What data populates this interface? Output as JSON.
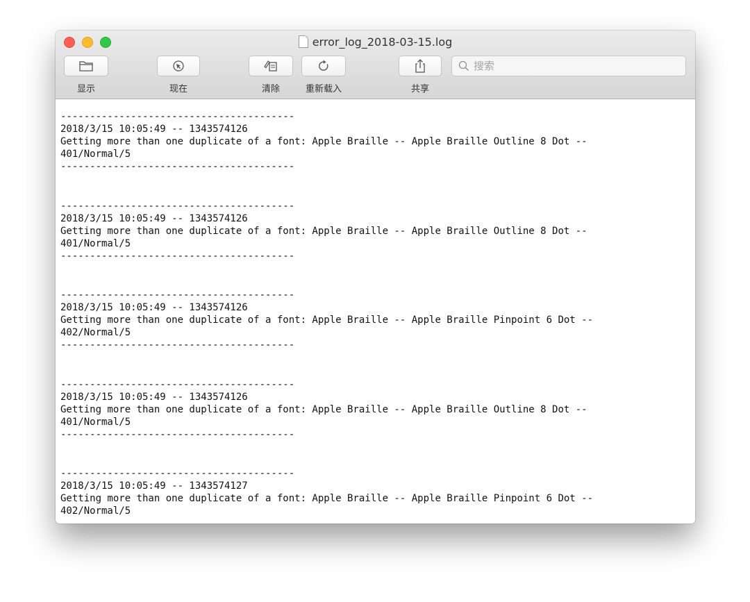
{
  "window": {
    "title": "error_log_2018-03-15.log"
  },
  "toolbar": {
    "show_label": "显示",
    "now_label": "现在",
    "clear_label": "清除",
    "reload_label": "重新载入",
    "share_label": "共享",
    "search_placeholder": "搜索"
  },
  "icons": {
    "sidebar": "folder-icon",
    "now": "cursor-arrow-icon",
    "clear": "clear-log-icon",
    "reload": "reload-icon",
    "share": "share-icon",
    "search": "magnifier-icon"
  },
  "log": {
    "separator": "----------------------------------------",
    "entries": [
      {
        "timestamp": "2018/3/15 10:05:49 -- 1343574126",
        "message": "Getting more than one duplicate of a font: Apple Braille -- Apple Braille Outline 8 Dot --",
        "detail": "401/Normal/5"
      },
      {
        "timestamp": "2018/3/15 10:05:49 -- 1343574126",
        "message": "Getting more than one duplicate of a font: Apple Braille -- Apple Braille Outline 8 Dot --",
        "detail": "401/Normal/5"
      },
      {
        "timestamp": "2018/3/15 10:05:49 -- 1343574126",
        "message": "Getting more than one duplicate of a font: Apple Braille -- Apple Braille Pinpoint 6 Dot --",
        "detail": "402/Normal/5"
      },
      {
        "timestamp": "2018/3/15 10:05:49 -- 1343574126",
        "message": "Getting more than one duplicate of a font: Apple Braille -- Apple Braille Outline 8 Dot --",
        "detail": "401/Normal/5"
      },
      {
        "timestamp": "2018/3/15 10:05:49 -- 1343574127",
        "message": "Getting more than one duplicate of a font: Apple Braille -- Apple Braille Pinpoint 6 Dot --",
        "detail": "402/Normal/5"
      }
    ]
  }
}
